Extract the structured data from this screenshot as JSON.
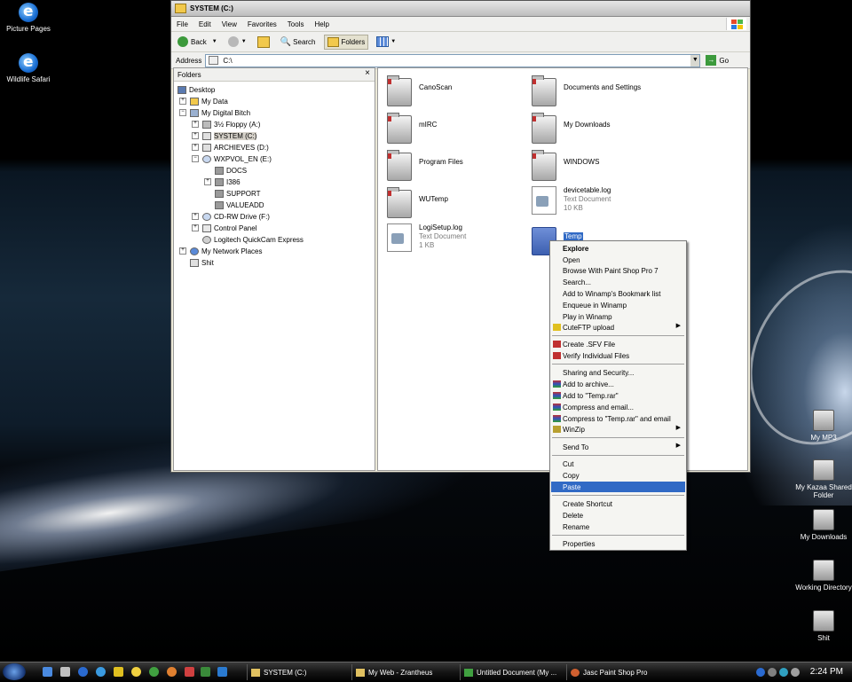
{
  "desktop": {
    "left_icons": [
      "Picture Pages",
      "Wildlife Safari"
    ],
    "right_icons": [
      "My MP3",
      "My Kazaa Shared Folder",
      "My Downloads",
      "Working Directory",
      "Shit"
    ]
  },
  "window": {
    "title": "SYSTEM (C:)",
    "menu": [
      "File",
      "Edit",
      "View",
      "Favorites",
      "Tools",
      "Help"
    ],
    "toolbar": {
      "back": "Back",
      "search": "Search",
      "folders": "Folders"
    },
    "address_label": "Address",
    "address_value": "C:\\",
    "go": "Go",
    "folders_pane_title": "Folders",
    "close_pane": "×"
  },
  "tree": [
    {
      "label": "Desktop"
    },
    {
      "label": "My Data",
      "pm": "+"
    },
    {
      "label": "My Digital Bitch",
      "pm": "−"
    },
    {
      "label": "3½ Floppy (A:)",
      "pm": "+"
    },
    {
      "label": "SYSTEM (C:)",
      "pm": "+"
    },
    {
      "label": "ARCHIEVES (D:)",
      "pm": "+"
    },
    {
      "label": "WXPVOL_EN (E:)",
      "pm": "−"
    },
    {
      "label": "DOCS"
    },
    {
      "label": "I386",
      "pm": "+"
    },
    {
      "label": "SUPPORT"
    },
    {
      "label": "VALUEADD"
    },
    {
      "label": "CD-RW Drive (F:)",
      "pm": "+"
    },
    {
      "label": "Control Panel",
      "pm": "+"
    },
    {
      "label": "Logitech QuickCam Express"
    },
    {
      "label": "My Network Places",
      "pm": "+"
    },
    {
      "label": "Shit"
    }
  ],
  "files": [
    {
      "name": "CanoScan"
    },
    {
      "name": "Documents and Settings"
    },
    {
      "name": "mIRC"
    },
    {
      "name": "My Downloads"
    },
    {
      "name": "Program Files"
    },
    {
      "name": "WINDOWS"
    },
    {
      "name": "WUTemp"
    },
    {
      "name": "devicetable.log",
      "type": "Text Document",
      "size": "10 KB"
    },
    {
      "name": "LogiSetup.log",
      "type": "Text Document",
      "size": "1 KB"
    },
    {
      "name": "Temp"
    }
  ],
  "context_menu": [
    "Explore",
    "Open",
    "Browse With Paint Shop Pro 7",
    "Search...",
    "Add to Winamp's Bookmark list",
    "Enqueue in Winamp",
    "Play in Winamp",
    "CuteFTP upload",
    "Create .SFV File",
    "Verify Individual Files",
    "Sharing and Security...",
    "Add to archive...",
    "Add to \"Temp.rar\"",
    "Compress and email...",
    "Compress to \"Temp.rar\" and email",
    "WinZip",
    "Send To",
    "Cut",
    "Copy",
    "Paste",
    "Create Shortcut",
    "Delete",
    "Rename",
    "Properties"
  ],
  "taskbar": {
    "tasks": [
      "SYSTEM (C:)",
      "My Web - Zrantheus",
      "Untitled Document (My ...",
      "Jasc Paint Shop Pro"
    ],
    "clock": "2:24 PM"
  },
  "colors": {
    "selection": "#316ac5",
    "window_bg": "#ece9d8"
  }
}
